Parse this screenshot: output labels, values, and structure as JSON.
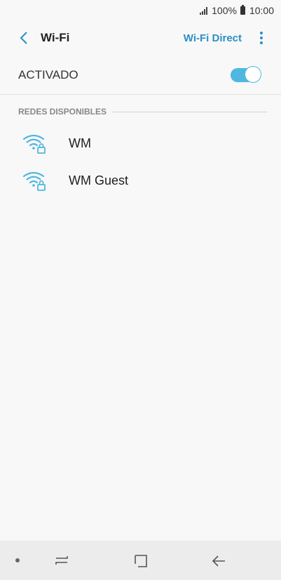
{
  "status_bar": {
    "battery": "100%",
    "time": "10:00"
  },
  "app_bar": {
    "title": "Wi-Fi",
    "action_label": "Wi-Fi Direct"
  },
  "toggle": {
    "label": "ACTIVADO",
    "state": "on"
  },
  "section": {
    "title": "REDES DISPONIBLES"
  },
  "networks": [
    {
      "name": "WM",
      "icon": "wifi-lock-icon"
    },
    {
      "name": "WM Guest",
      "icon": "wifi-lock-icon"
    }
  ],
  "colors": {
    "accent": "#2b8fc5",
    "switch_on": "#4fb7e0",
    "wifi_icon": "#4fb7e0",
    "background": "#f8f8f8"
  }
}
